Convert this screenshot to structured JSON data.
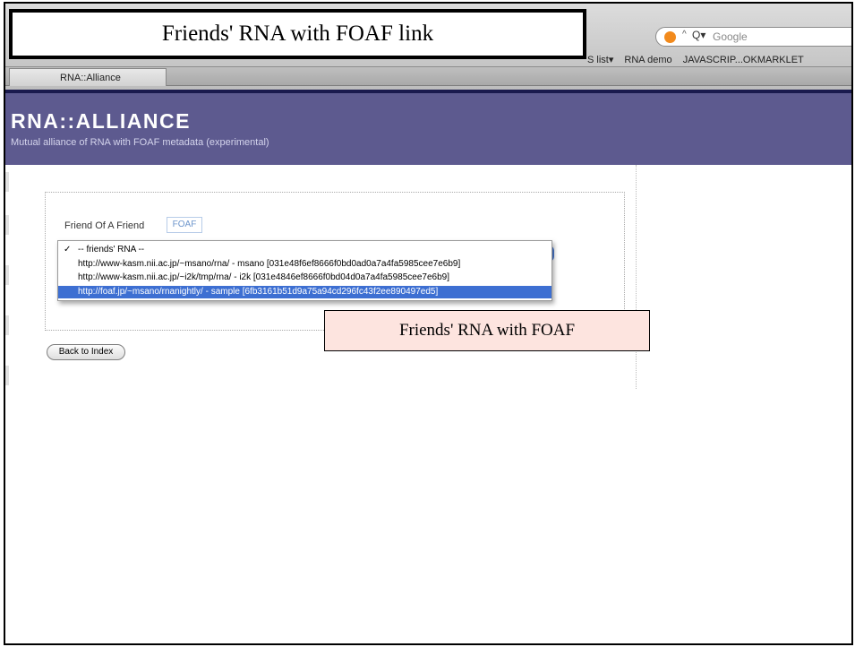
{
  "slide": {
    "title": "Friends' RNA with FOAF link",
    "caption": "Friends' RNA with FOAF"
  },
  "browser": {
    "search_placeholder": "Google",
    "bookmarks": [
      "S list▾",
      "RNA demo",
      "JAVASCRIP...OKMARKLET"
    ],
    "tab_label": "RNA::Alliance"
  },
  "site": {
    "title": "RNA::ALLIANCE",
    "subtitle": "Mutual alliance of RNA with FOAF metadata (experimental)"
  },
  "form": {
    "label": "Friend Of A Friend",
    "badge": "FOAF"
  },
  "dropdown": {
    "options": [
      {
        "check": "✓",
        "label": "-- friends' RNA --",
        "selected": false
      },
      {
        "check": "",
        "label": "http://www-kasm.nii.ac.jp/~msano/rna/   - msano [031e48f6ef8666f0bd0ad0a7a4fa5985cee7e6b9]",
        "selected": false
      },
      {
        "check": "",
        "label": "http://www-kasm.nii.ac.jp/~i2k/tmp/rna/   - i2k [031e4846ef8666f0bd04d0a7a4fa5985cee7e6b9]",
        "selected": false
      },
      {
        "check": "",
        "label": "http://foaf.jp/~msano/rnanightly/   - sample [6fb3161b51d9a75a94cd296fc43f2ee890497ed5]",
        "selected": true
      }
    ]
  },
  "back_button": "Back to Index",
  "colors": {
    "banner": "#5d5a8f",
    "selection": "#3d6fd2",
    "caption_bg": "#fde4df"
  }
}
